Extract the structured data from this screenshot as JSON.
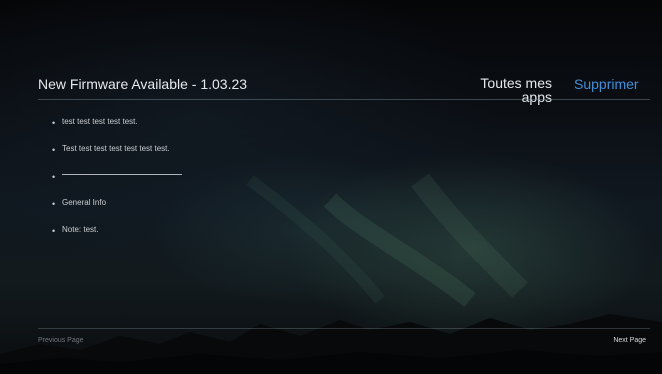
{
  "header": {
    "title": "New Firmware Available - 1.03.23",
    "apps_label": "Toutes mes apps",
    "delete_label": "Supprimer"
  },
  "notes": [
    {
      "text": "test test test test test."
    },
    {
      "text": "Test test test test test test test."
    },
    {
      "text": ""
    },
    {
      "text": "General Info"
    },
    {
      "text": "Note: test."
    }
  ],
  "footer": {
    "previous_label": "Previous Page",
    "next_label": "Next Page"
  },
  "colors": {
    "accent": "#3f8fdc",
    "text": "#e6e9ec",
    "muted": "#6f767c"
  },
  "icons": {
    "bullet": "bullet-icon"
  }
}
